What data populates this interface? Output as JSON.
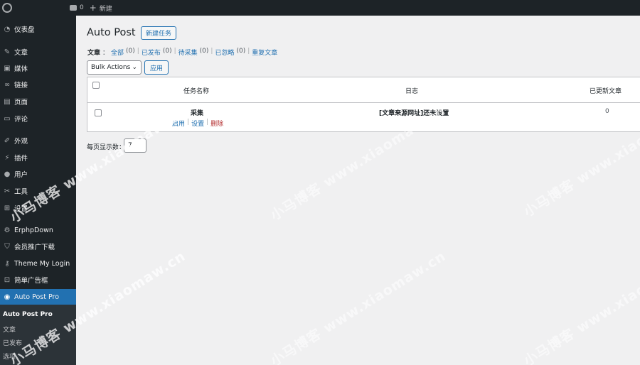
{
  "adminbar": {
    "comments_count": "0",
    "new_label": "新建"
  },
  "sidebar": {
    "items": [
      {
        "label": "仪表盘",
        "icon": "dashboard-icon"
      },
      {
        "label": "文章",
        "icon": "pin-icon"
      },
      {
        "label": "媒体",
        "icon": "media-icon"
      },
      {
        "label": "链接",
        "icon": "link-icon"
      },
      {
        "label": "页面",
        "icon": "page-icon"
      },
      {
        "label": "评论",
        "icon": "comment-icon"
      },
      {
        "label": "外观",
        "icon": "brush-icon"
      },
      {
        "label": "插件",
        "icon": "plugin-icon"
      },
      {
        "label": "用户",
        "icon": "user-icon"
      },
      {
        "label": "工具",
        "icon": "wrench-icon"
      },
      {
        "label": "设置",
        "icon": "settings-icon"
      },
      {
        "label": "ErphpDown",
        "icon": "download-icon"
      },
      {
        "label": "会员推广下载",
        "icon": "shield-icon"
      },
      {
        "label": "Theme My Login",
        "icon": "key-icon"
      },
      {
        "label": "简单广告框",
        "icon": "ad-icon"
      },
      {
        "label": "Auto Post Pro",
        "icon": "autopost-icon"
      }
    ],
    "submenu": [
      {
        "label": "Auto Post Pro"
      },
      {
        "label": "文章"
      },
      {
        "label": "已发布"
      },
      {
        "label": "选项"
      }
    ]
  },
  "main": {
    "title": "Auto Post",
    "new_task_button": "新建任务",
    "filter": {
      "label": "文章",
      "colon": "：",
      "links": [
        {
          "label": "全部",
          "count": "(0)"
        },
        {
          "label": "已发布",
          "count": "(0)"
        },
        {
          "label": "待采集",
          "count": "(0)"
        },
        {
          "label": "已忽略",
          "count": "(0)"
        },
        {
          "label": "重复文章",
          "count": ""
        }
      ]
    },
    "bulk_actions": "Bulk Actions",
    "apply_button": "应用",
    "table": {
      "headers": [
        "任务名称",
        "日志",
        "已更新文章"
      ],
      "rows": [
        {
          "name": "采集",
          "log": "[文章来源网址]还未设置",
          "updated": "0",
          "actions": {
            "enable": "启用",
            "settings": "设置",
            "delete": "删除"
          }
        }
      ]
    },
    "per_page_label": "每页显示数：",
    "per_page_value": "7"
  },
  "watermark": {
    "text_cn": "小马博客",
    "text_url": "www.xiaomaw.cn"
  },
  "colors": {
    "sidebar_bg": "#1d2327",
    "accent": "#2271b1",
    "danger": "#b32d2e",
    "content_bg": "#f0f0f1"
  }
}
